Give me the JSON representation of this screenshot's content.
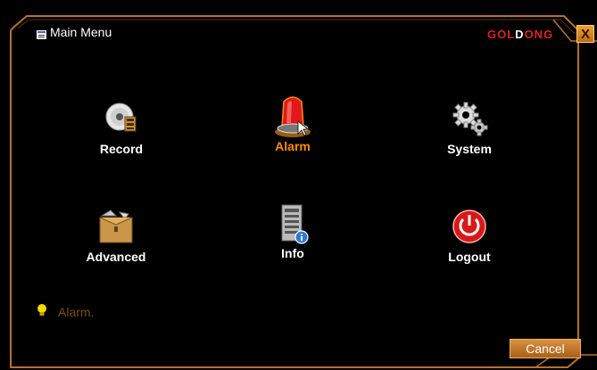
{
  "window": {
    "title": "Main Menu",
    "brand_part1": "GOL",
    "brand_part2": "D",
    "brand_part3": "ONG",
    "close_label": "X"
  },
  "menu": {
    "items": [
      {
        "label": "Record",
        "icon": "record-disc-icon",
        "active": false
      },
      {
        "label": "Alarm",
        "icon": "alarm-siren-icon",
        "active": true
      },
      {
        "label": "System",
        "icon": "gears-icon",
        "active": false
      },
      {
        "label": "Advanced",
        "icon": "toolbox-icon",
        "active": false
      },
      {
        "label": "Info",
        "icon": "info-device-icon",
        "active": false
      },
      {
        "label": "Logout",
        "icon": "power-icon",
        "active": false
      }
    ]
  },
  "status": {
    "text": "Alarm.",
    "icon": "lightbulb-icon"
  },
  "footer": {
    "cancel_label": "Cancel"
  },
  "colors": {
    "accent": "#ff8a00",
    "frame": "#c8782a",
    "background": "#000000"
  }
}
